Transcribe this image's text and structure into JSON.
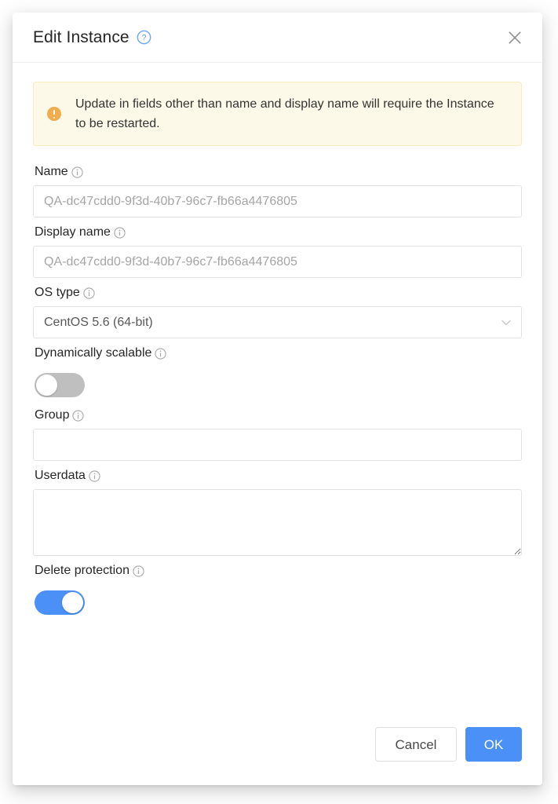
{
  "dialog": {
    "title": "Edit Instance",
    "help_icon": "question-circle-icon",
    "close_icon": "close-icon"
  },
  "alert": {
    "icon": "exclamation-circle-icon",
    "message": "Update in fields other than name and display name will require the Instance to be restarted.",
    "background_color": "#fdf9e9",
    "icon_color": "#f0ad4e"
  },
  "fields": {
    "name": {
      "label": "Name",
      "info_icon": "info-circle-icon",
      "value": "",
      "placeholder": "QA-dc47cdd0-9f3d-40b7-96c7-fb66a4476805"
    },
    "display_name": {
      "label": "Display name",
      "info_icon": "info-circle-icon",
      "value": "",
      "placeholder": "QA-dc47cdd0-9f3d-40b7-96c7-fb66a4476805"
    },
    "os_type": {
      "label": "OS type",
      "info_icon": "info-circle-icon",
      "selected": "CentOS 5.6 (64-bit)",
      "chevron_icon": "chevron-down-icon"
    },
    "dynamically_scalable": {
      "label": "Dynamically scalable",
      "info_icon": "info-circle-icon",
      "state": "off"
    },
    "group": {
      "label": "Group",
      "info_icon": "info-circle-icon",
      "value": "",
      "placeholder": ""
    },
    "userdata": {
      "label": "Userdata",
      "info_icon": "info-circle-icon",
      "value": "",
      "placeholder": ""
    },
    "delete_protection": {
      "label": "Delete protection",
      "info_icon": "info-circle-icon",
      "state": "on"
    }
  },
  "footer": {
    "cancel_label": "Cancel",
    "ok_label": "OK",
    "primary_color": "#4a90f7"
  }
}
